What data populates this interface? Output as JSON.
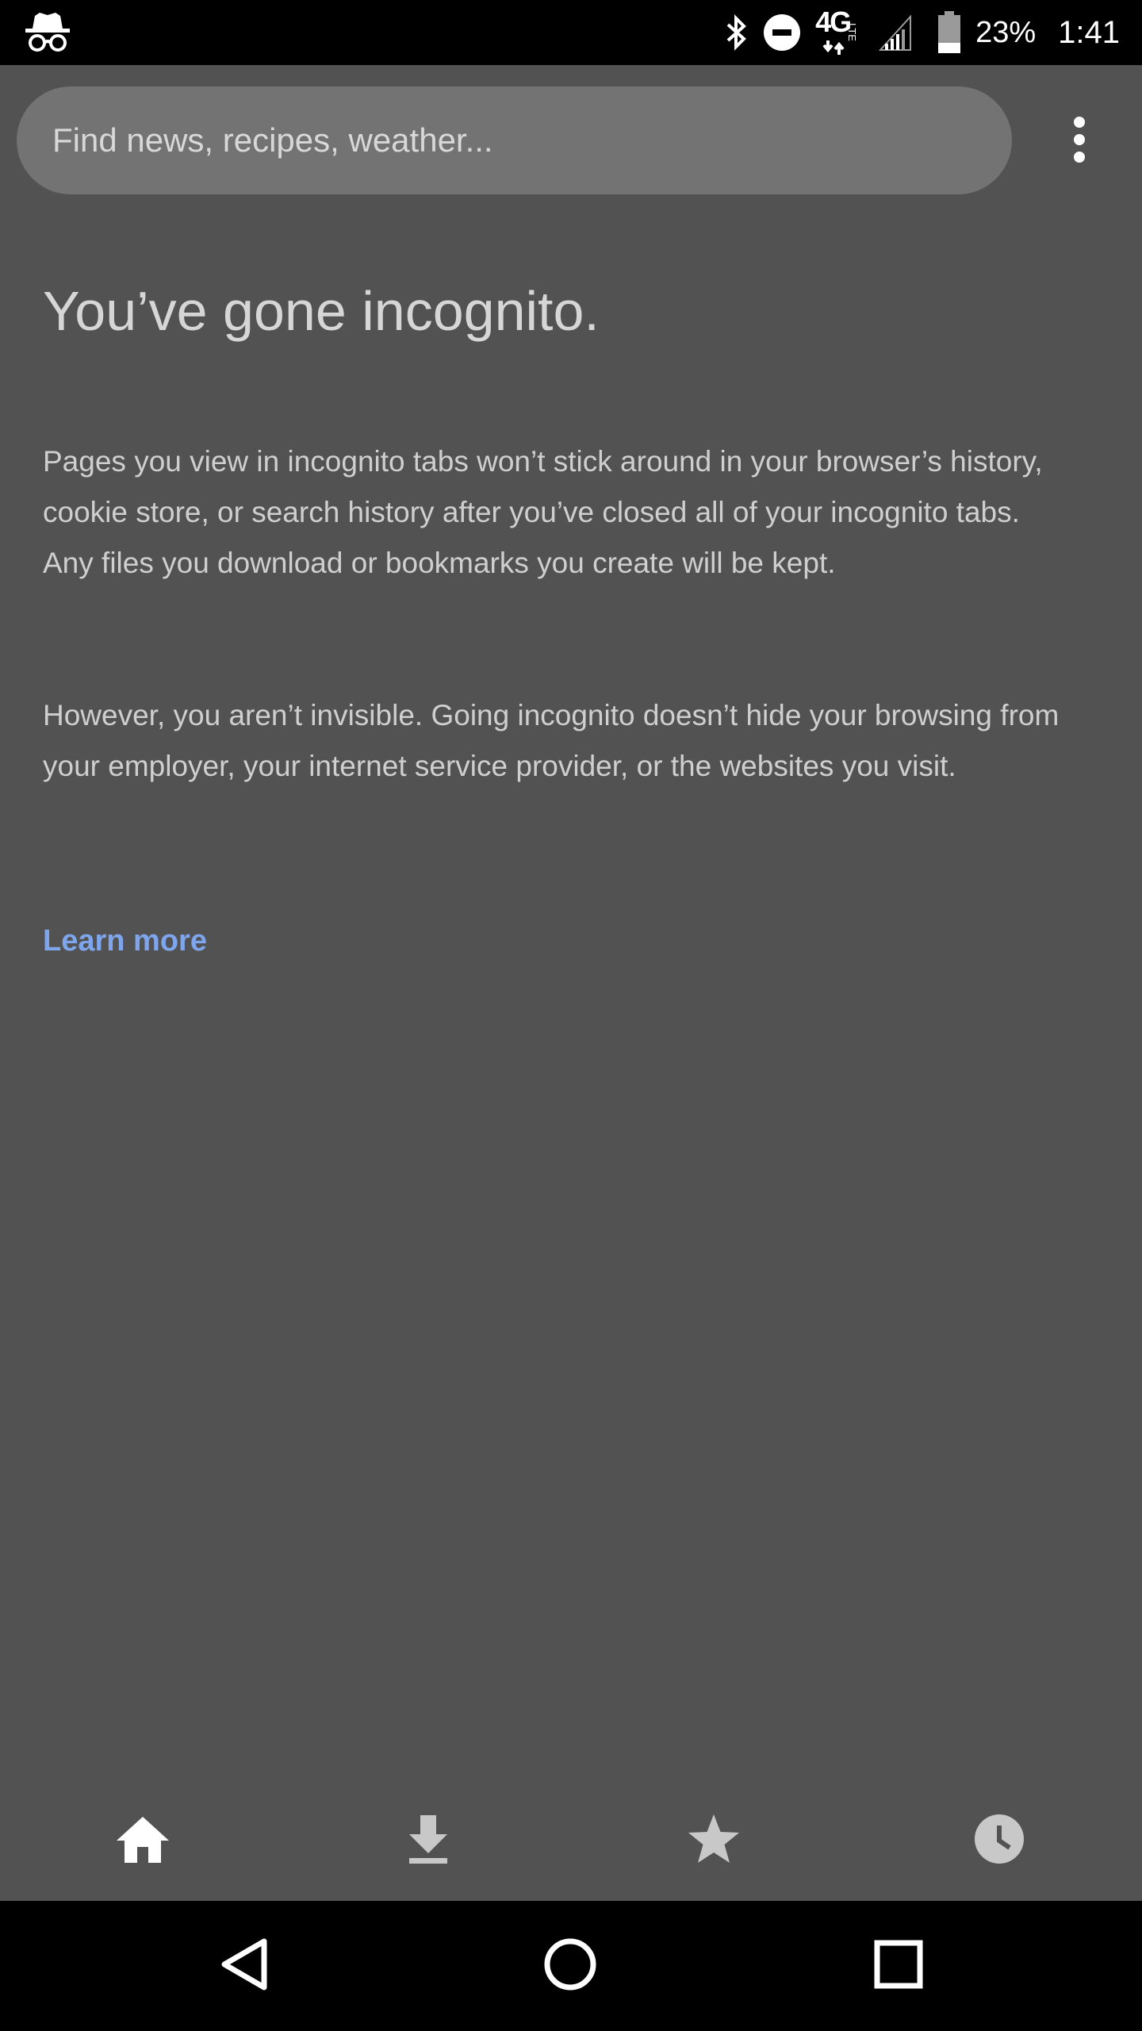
{
  "status_bar": {
    "battery_percent": "23%",
    "time": "1:41",
    "network_label": "4G",
    "icons": [
      "incognito-icon",
      "bluetooth-icon",
      "do-not-disturb-icon",
      "network-4g-lte-icon",
      "signal-icon",
      "battery-icon"
    ]
  },
  "search": {
    "placeholder": "Find news, recipes, weather..."
  },
  "menu": {
    "icon": "more-vert-icon"
  },
  "content": {
    "title": "You’ve gone incognito.",
    "paragraph1": "Pages you view in incognito tabs won’t stick around in your browser’s history, cookie store, or search history after you’ve closed all of your incognito tabs. Any files you download or bookmarks you create will be kept.",
    "paragraph2": "However, you aren’t invisible. Going incognito doesn’t hide your browsing from your employer, your internet service provider, or the websites you visit.",
    "learn_more": "Learn more"
  },
  "bottom_toolbar": {
    "items": [
      {
        "icon": "home-icon",
        "active": true
      },
      {
        "icon": "download-icon",
        "active": false
      },
      {
        "icon": "star-icon",
        "active": false
      },
      {
        "icon": "history-icon",
        "active": false
      }
    ]
  },
  "nav_bar": {
    "items": [
      "back-icon",
      "home-circle-icon",
      "recents-icon"
    ]
  },
  "colors": {
    "background": "#525252",
    "search_pill": "#737373",
    "link": "#7fa6ec",
    "status_bar": "#000000"
  }
}
